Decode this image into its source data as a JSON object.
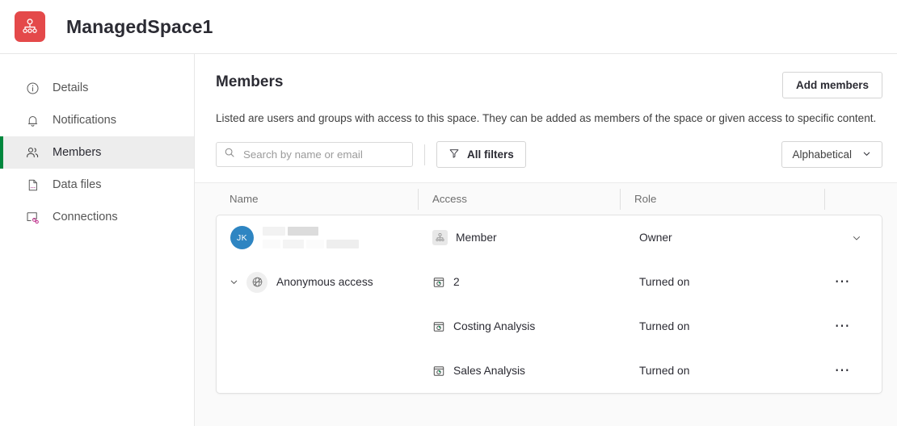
{
  "header": {
    "space_title": "ManagedSpace1",
    "logo_icon": "space-hierarchy-icon",
    "logo_color": "#e4494a"
  },
  "sidebar": {
    "items": [
      {
        "label": "Details",
        "icon": "info-circle-icon",
        "active": false
      },
      {
        "label": "Notifications",
        "icon": "bell-icon",
        "active": false
      },
      {
        "label": "Members",
        "icon": "people-icon",
        "active": true
      },
      {
        "label": "Data files",
        "icon": "file-data-icon",
        "active": false
      },
      {
        "label": "Connections",
        "icon": "connections-icon",
        "active": false
      }
    ],
    "active_accent": "#00873d"
  },
  "main": {
    "title": "Members",
    "description": "Listed are users and groups with access to this space. They can be added as members of the space or given access to specific content.",
    "add_members_label": "Add members",
    "search": {
      "placeholder": "Search by name or email",
      "value": "",
      "icon": "search-icon"
    },
    "filters": {
      "label": "All filters",
      "icon": "funnel-icon"
    },
    "sort": {
      "label": "Alphabetical",
      "icon": "chevron-down-icon"
    },
    "table": {
      "columns": [
        "Name",
        "Access",
        "Role",
        ""
      ],
      "rows": [
        {
          "type": "user",
          "avatar_initials": "JK",
          "avatar_color": "#2e85c2",
          "name_redacted": true,
          "access_label": "Member",
          "access_icon": "member-hierarchy-icon",
          "role": "Owner",
          "action": "chevron-down-icon"
        },
        {
          "type": "group",
          "expand_icon": "chevron-down-icon",
          "name": "Anonymous access",
          "name_icon": "globe-icon",
          "access_label": "2",
          "access_icon": "app-icon",
          "role": "Turned on",
          "action": "more-options-icon"
        },
        {
          "type": "content",
          "name": "",
          "access_label": "Costing Analysis",
          "access_icon": "app-icon",
          "role": "Turned on",
          "action": "more-options-icon"
        },
        {
          "type": "content",
          "name": "",
          "access_label": "Sales Analysis",
          "access_icon": "app-icon",
          "role": "Turned on",
          "action": "more-options-icon"
        }
      ]
    }
  }
}
